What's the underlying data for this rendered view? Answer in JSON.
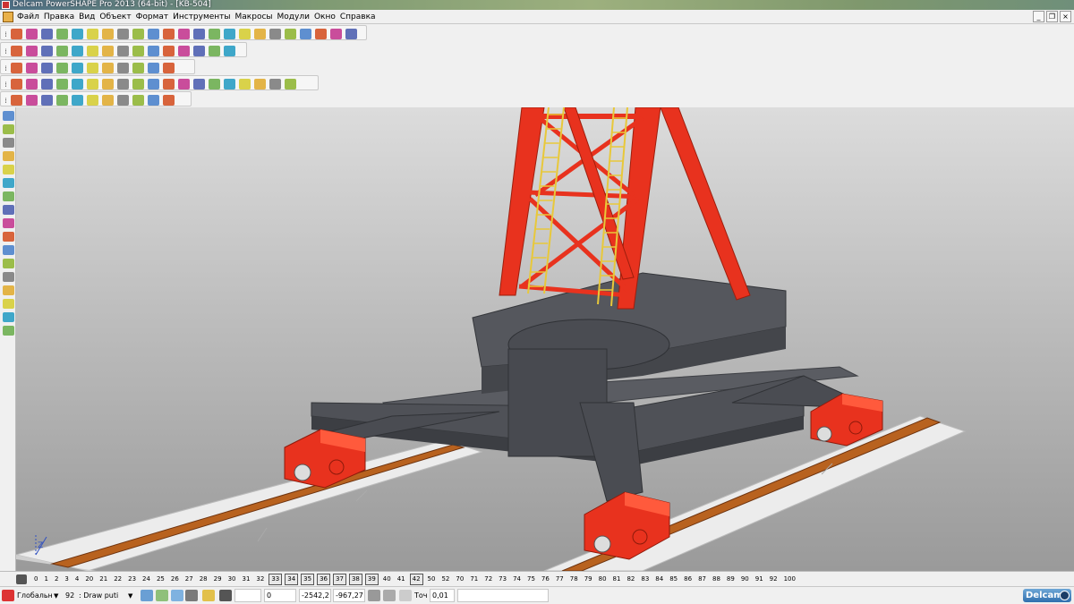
{
  "window": {
    "title": "Delcam PowerSHAPE Pro 2013 (64-bit) - [KB-504]"
  },
  "menu": {
    "items": [
      "Файл",
      "Правка",
      "Вид",
      "Объект",
      "Формат",
      "Инструменты",
      "Макросы",
      "Модули",
      "Окно",
      "Справка"
    ],
    "window_buttons": [
      "_",
      "❐",
      "×"
    ]
  },
  "toolbars": {
    "rows": 5,
    "icon_names": [
      "new-icon",
      "open-icon",
      "save-icon",
      "print-icon",
      "cut-icon",
      "copy-icon",
      "paste-icon",
      "undo-icon",
      "redo-icon",
      "select-icon",
      "zoom-icon",
      "rotate-icon",
      "shade-icon",
      "wireframe-icon",
      "view-icon",
      "layer-icon"
    ]
  },
  "levels": {
    "items": [
      "0",
      "1",
      "2",
      "3",
      "4",
      "20",
      "21",
      "22",
      "23",
      "24",
      "25",
      "26",
      "27",
      "28",
      "29",
      "30",
      "31",
      "32",
      "33",
      "34",
      "35",
      "36",
      "37",
      "38",
      "39",
      "40",
      "41",
      "42",
      "50",
      "52",
      "70",
      "71",
      "72",
      "73",
      "74",
      "75",
      "76",
      "77",
      "78",
      "79",
      "80",
      "81",
      "82",
      "83",
      "84",
      "85",
      "86",
      "87",
      "88",
      "89",
      "90",
      "91",
      "92",
      "100"
    ],
    "boxed": [
      "33",
      "34",
      "35",
      "36",
      "37",
      "38",
      "39",
      "42"
    ]
  },
  "status": {
    "workplane": "Глобальн",
    "level_num": "92",
    "level_name": "Draw puti",
    "coord_x": "0",
    "coord_y": "-2542,2",
    "coord_z": "-967,27",
    "tolerance_label": "Точ",
    "tolerance_value": "0,01",
    "brand": "Delcam"
  },
  "viewport": {
    "axis_label": "Z"
  },
  "colors": {
    "crane_red": "#e8321e",
    "ladder_yellow": "#e8c83a",
    "base_gray": "#4f5157",
    "rail_brown": "#8a4a1c",
    "sleeper_white": "#eaeaea"
  }
}
